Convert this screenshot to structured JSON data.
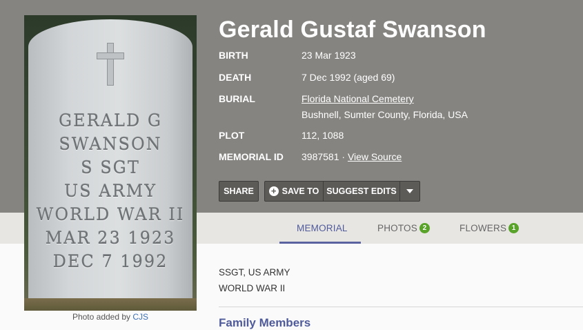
{
  "memorial": {
    "name": "Gerald Gustaf Swanson",
    "facts": [
      {
        "label": "BIRTH",
        "value": "23 Mar 1923"
      },
      {
        "label": "DEATH",
        "value": "7 Dec 1992 (aged 69)"
      },
      {
        "label": "BURIAL",
        "value": "Florida National Cemetery",
        "value2": "Bushnell, Sumter County, Florida, USA"
      },
      {
        "label": "PLOT",
        "value": "112, 1088"
      },
      {
        "label": "MEMORIAL ID",
        "value": "3987581 · ",
        "link": "View Source"
      }
    ]
  },
  "photo": {
    "inscription": [
      "GERALD G",
      "SWANSON",
      "S SGT",
      "US ARMY",
      "WORLD WAR II",
      "MAR 23 1923",
      "DEC 7 1992"
    ],
    "caption_prefix": "Photo added by ",
    "caption_author": "CJS"
  },
  "actions": {
    "share": "SHARE",
    "save_to": "SAVE TO",
    "suggest_edits": "SUGGEST EDITS"
  },
  "tabs": [
    {
      "label": "MEMORIAL",
      "active": true
    },
    {
      "label": "PHOTOS",
      "badge": "2"
    },
    {
      "label": "FLOWERS",
      "badge": "1"
    }
  ],
  "bio": {
    "lines": [
      "SSGT, US ARMY",
      "WORLD WAR II"
    ]
  },
  "section_heading": "Family Members",
  "colors": {
    "header_bg": "#868480",
    "accent": "#4f5a9a",
    "badge": "#5aa32a"
  }
}
